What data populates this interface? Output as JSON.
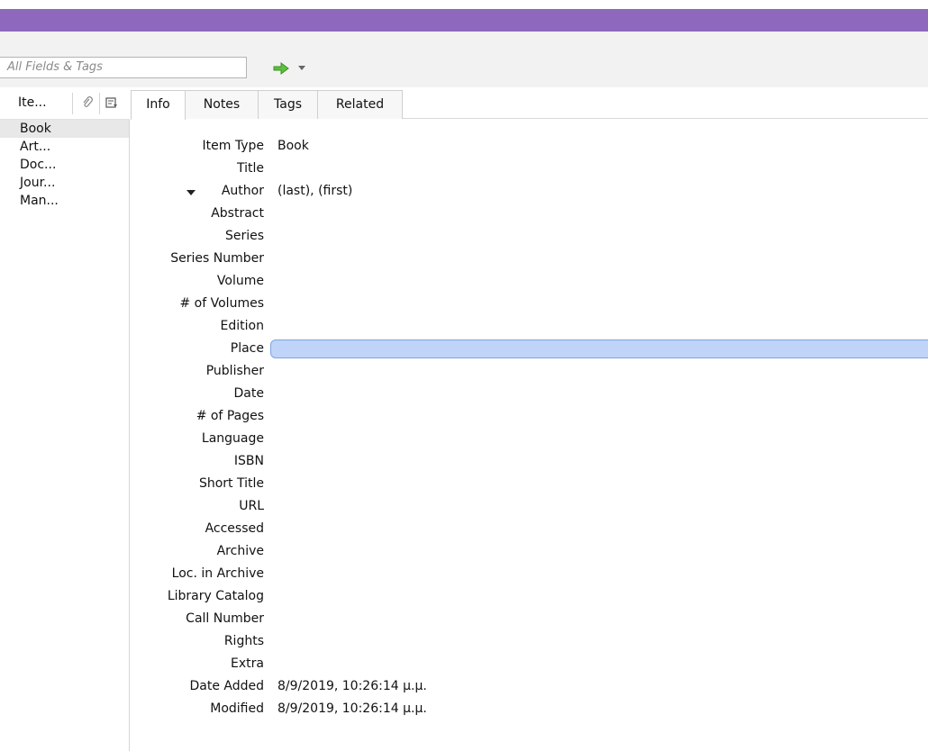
{
  "search": {
    "placeholder": "All Fields & Tags"
  },
  "items_pane": {
    "column_title": "Ite...",
    "rows": [
      "Book",
      "Art...",
      "Doc...",
      "Jour...",
      "Man..."
    ]
  },
  "tabs": [
    "Info",
    "Notes",
    "Tags",
    "Related"
  ],
  "fields": {
    "item_type": {
      "label": "Item Type",
      "value": "Book"
    },
    "title": {
      "label": "Title"
    },
    "author": {
      "label": "Author",
      "value": "(last), (first)"
    },
    "abstract": {
      "label": "Abstract"
    },
    "series": {
      "label": "Series"
    },
    "series_number": {
      "label": "Series Number"
    },
    "volume": {
      "label": "Volume"
    },
    "num_volumes": {
      "label": "# of Volumes"
    },
    "edition": {
      "label": "Edition"
    },
    "place": {
      "label": "Place"
    },
    "publisher": {
      "label": "Publisher"
    },
    "date": {
      "label": "Date"
    },
    "num_pages": {
      "label": "# of Pages"
    },
    "language": {
      "label": "Language"
    },
    "isbn": {
      "label": "ISBN"
    },
    "short_title": {
      "label": "Short Title"
    },
    "url": {
      "label": "URL"
    },
    "accessed": {
      "label": "Accessed"
    },
    "archive": {
      "label": "Archive"
    },
    "loc_in_archive": {
      "label": "Loc. in Archive"
    },
    "library_catalog": {
      "label": "Library Catalog"
    },
    "call_number": {
      "label": "Call Number"
    },
    "rights": {
      "label": "Rights"
    },
    "extra": {
      "label": "Extra"
    },
    "date_added": {
      "label": "Date Added",
      "value": "8/9/2019, 10:26:14 μ.μ."
    },
    "modified": {
      "label": "Modified",
      "value": "8/9/2019, 10:26:14 μ.μ."
    }
  },
  "colors": {
    "title_bar": "#8e68bd",
    "place_highlight": "#bfd4f8",
    "go_arrow": "#5cc23a"
  }
}
